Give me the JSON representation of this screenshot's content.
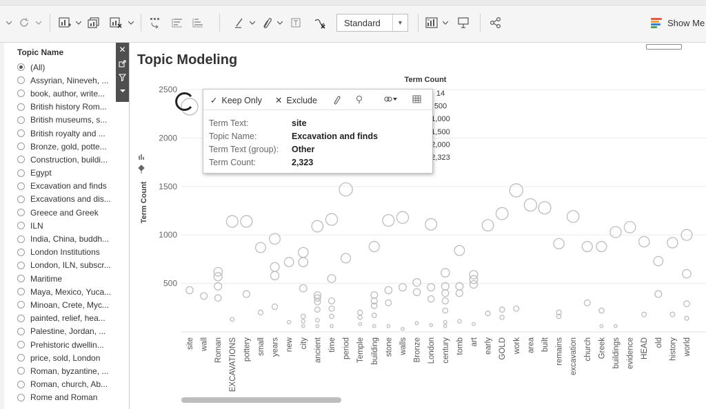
{
  "toolbar": {
    "mark_type": "Standard",
    "show_me_label": "Show Me",
    "show_me_colors": [
      "#e05a48",
      "#f2a33a",
      "#3d7cc9",
      "#4aa35c"
    ]
  },
  "sidebar": {
    "title": "Topic Name",
    "items": [
      {
        "label": "(All)",
        "selected": true
      },
      {
        "label": "Assyrian, Nineveh, ...",
        "selected": false
      },
      {
        "label": "book, author, write...",
        "selected": false
      },
      {
        "label": "British history Rom...",
        "selected": false
      },
      {
        "label": "British museums, s...",
        "selected": false
      },
      {
        "label": "British royalty and ...",
        "selected": false
      },
      {
        "label": "Bronze, gold, potte...",
        "selected": false
      },
      {
        "label": "Construction, buildi...",
        "selected": false
      },
      {
        "label": "Egypt",
        "selected": false
      },
      {
        "label": "Excavation and finds",
        "selected": false
      },
      {
        "label": "Excavations and dis...",
        "selected": false
      },
      {
        "label": "Greece and Greek",
        "selected": false
      },
      {
        "label": "ILN",
        "selected": false
      },
      {
        "label": "India, China, buddh...",
        "selected": false
      },
      {
        "label": "London Institutions",
        "selected": false
      },
      {
        "label": "London, ILN, subscr...",
        "selected": false
      },
      {
        "label": "Maritime",
        "selected": false
      },
      {
        "label": "Maya, Mexico, Yuca...",
        "selected": false
      },
      {
        "label": "Minoan, Crete, Myc...",
        "selected": false
      },
      {
        "label": "painted, relief, hea...",
        "selected": false
      },
      {
        "label": "Palestine, Jordan, ...",
        "selected": false
      },
      {
        "label": "Prehistoric dwellin...",
        "selected": false
      },
      {
        "label": "price, sold, London",
        "selected": false
      },
      {
        "label": "Roman, byzantine, ...",
        "selected": false
      },
      {
        "label": "Roman, church, Ab...",
        "selected": false
      },
      {
        "label": "Rome and Roman",
        "selected": false
      }
    ]
  },
  "sheet": {
    "title": "Topic Modeling"
  },
  "tooltip": {
    "actions": {
      "keep_only": "Keep Only",
      "exclude": "Exclude"
    },
    "rows": [
      {
        "key": "Term Text:",
        "value": "site"
      },
      {
        "key": "Topic Name:",
        "value": "Excavation and finds"
      },
      {
        "key": "Term Text (group):",
        "value": "Other"
      },
      {
        "key": "Term Count:",
        "value": "2,323"
      }
    ]
  },
  "chart_data": {
    "type": "scatter",
    "ylabel": "Term Count",
    "ylim": [
      0,
      2600
    ],
    "yticks": [
      500,
      1000,
      1500,
      2000,
      2500
    ],
    "grid": true,
    "legend": {
      "title": "Term Count",
      "entries": [
        "14",
        "500",
        "1,000",
        "1,500",
        "2,000",
        "2,323"
      ],
      "placement": "top"
    },
    "mark_color": "#bdbdbd",
    "categories": [
      "site",
      "wall",
      "Roman",
      "EXCAVATIONS",
      "pottery",
      "small",
      "years",
      "new",
      "city",
      "ancient",
      "time",
      "period",
      "Temple",
      "building",
      "stone",
      "walls",
      "Bronze",
      "London",
      "century",
      "tomb",
      "art",
      "early",
      "GOLD",
      "work",
      "area",
      "built",
      "remains",
      "excavation",
      "church",
      "Greek",
      "buildings",
      "evidence",
      "HEAD",
      "old",
      "history",
      "world"
    ],
    "points": [
      {
        "x": "site",
        "y": [
          430,
          2323
        ]
      },
      {
        "x": "wall",
        "y": [
          370
        ]
      },
      {
        "x": "Roman",
        "y": [
          350,
          470,
          570,
          620
        ]
      },
      {
        "x": "EXCAVATIONS",
        "y": [
          130,
          1140
        ]
      },
      {
        "x": "pottery",
        "y": [
          390,
          1140
        ]
      },
      {
        "x": "small",
        "y": [
          200,
          870
        ]
      },
      {
        "x": "years",
        "y": [
          260,
          580,
          670,
          960
        ]
      },
      {
        "x": "new",
        "y": [
          100,
          720
        ]
      },
      {
        "x": "city",
        "y": [
          60,
          110,
          160,
          450,
          720,
          820
        ]
      },
      {
        "x": "ancient",
        "y": [
          60,
          120,
          230,
          310,
          350,
          380,
          1090
        ]
      },
      {
        "x": "time",
        "y": [
          60,
          160,
          240,
          320,
          550,
          1160
        ]
      },
      {
        "x": "period",
        "y": [
          760,
          1470
        ]
      },
      {
        "x": "Temple",
        "y": [
          80,
          150,
          200
        ]
      },
      {
        "x": "building",
        "y": [
          60,
          170,
          270,
          320,
          380,
          880
        ]
      },
      {
        "x": "stone",
        "y": [
          60,
          300,
          430,
          1150
        ]
      },
      {
        "x": "walls",
        "y": [
          30,
          460,
          1180
        ]
      },
      {
        "x": "Bronze",
        "y": [
          90,
          410,
          510
        ]
      },
      {
        "x": "London",
        "y": [
          70,
          340,
          460,
          1110
        ]
      },
      {
        "x": "century",
        "y": [
          60,
          100,
          220,
          320,
          400,
          470,
          610
        ]
      },
      {
        "x": "tomb",
        "y": [
          110,
          400,
          470,
          840
        ]
      },
      {
        "x": "art",
        "y": [
          80,
          490,
          540,
          590
        ]
      },
      {
        "x": "early",
        "y": [
          190,
          1100
        ]
      },
      {
        "x": "GOLD",
        "y": [
          150,
          230,
          1220
        ]
      },
      {
        "x": "work",
        "y": [
          240,
          1460
        ]
      },
      {
        "x": "area",
        "y": [
          1310
        ]
      },
      {
        "x": "built",
        "y": [
          1280
        ]
      },
      {
        "x": "remains",
        "y": [
          160,
          200,
          910
        ]
      },
      {
        "x": "excavation",
        "y": [
          1190
        ]
      },
      {
        "x": "church",
        "y": [
          300,
          880
        ]
      },
      {
        "x": "Greek",
        "y": [
          60,
          220,
          880
        ]
      },
      {
        "x": "buildings",
        "y": [
          60,
          1030
        ]
      },
      {
        "x": "evidence",
        "y": [
          1080
        ]
      },
      {
        "x": "HEAD",
        "y": [
          180,
          930
        ]
      },
      {
        "x": "old",
        "y": [
          390,
          730
        ]
      },
      {
        "x": "history",
        "y": [
          180,
          920
        ]
      },
      {
        "x": "world",
        "y": [
          140,
          290,
          600,
          1000
        ]
      }
    ]
  }
}
